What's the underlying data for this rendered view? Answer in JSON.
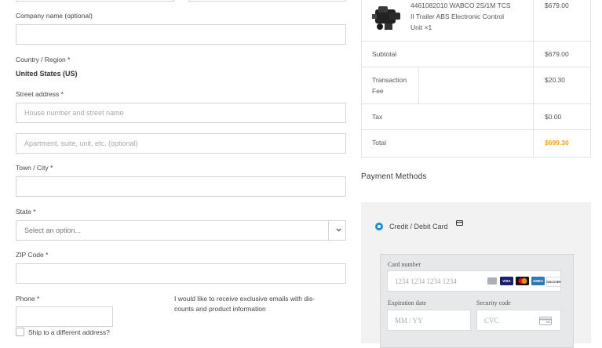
{
  "billing": {
    "company_label": "Company name (optional)",
    "country_label": "Country / Region",
    "country_value": "United States (US)",
    "street_label": "Street address",
    "street_placeholder": "House number and street name",
    "street2_placeholder": "Apartment, suite, unit, etc. (optional)",
    "city_label": "Town / City",
    "state_label": "State",
    "state_placeholder": "Select an option...",
    "zip_label": "ZIP Code",
    "phone_label": "Phone",
    "required_mark": "*",
    "newsletter_text_line1": "I would like to receive exclusive emails with dis-",
    "newsletter_text_line2": "counts and product information",
    "ship_different_label": "Ship to a different address?"
  },
  "order_summary": {
    "product_line1": "4461082010 WABCO 2S/1M TCS",
    "product_line2": "II Trailer ABS Electronic Control",
    "product_line3": "Unit ×1",
    "product_price": "$679.00",
    "subtotal_label": "Subtotal",
    "subtotal_value": "$679.00",
    "fee_label_line1": "Transaction",
    "fee_label_line2": "Fee",
    "fee_value": "$20.30",
    "tax_label": "Tax",
    "tax_value": "$0.00",
    "total_label": "Total",
    "total_value": "$699.30",
    "total_color": "#f0a21a"
  },
  "payment": {
    "title": "Payment Methods",
    "method_label": "Credit / Debit Card",
    "radio_color": "#1e90d8",
    "card_number_label": "Card number",
    "card_number_placeholder": "1234 1234 1234 1234",
    "expiration_label": "Expiration date",
    "expiration_placeholder": "MM / YY",
    "security_label": "Security code",
    "security_placeholder": "CVC",
    "brands": [
      "VISA",
      "mastercard",
      "AMEX",
      "DISCOVER"
    ]
  }
}
